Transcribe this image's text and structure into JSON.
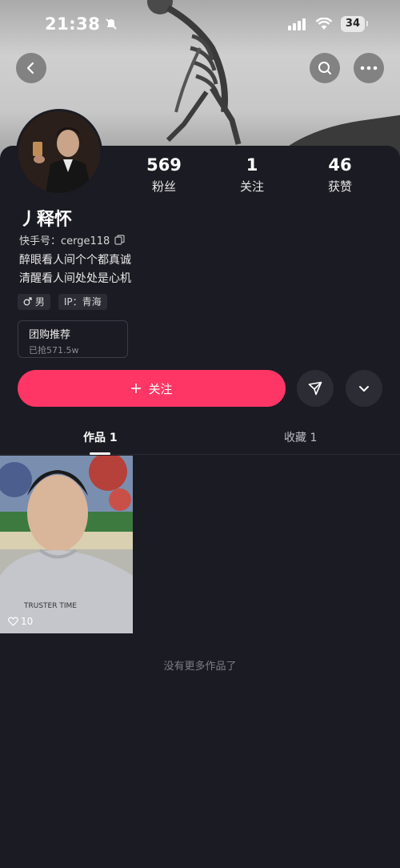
{
  "status_bar": {
    "time": "21:38",
    "battery": "34"
  },
  "profile": {
    "stats": [
      {
        "value": "569",
        "label": "粉丝"
      },
      {
        "value": "1",
        "label": "关注"
      },
      {
        "value": "46",
        "label": "获赞"
      }
    ],
    "nickname": "丿释怀",
    "kuaishou_id": "快手号：cerge118",
    "bio_line1": "醉眼看人间个个都真诚",
    "bio_line2": "清醒看人间处处是心机",
    "gender_tag": "男",
    "ip_tag": "IP：青海",
    "group_buy": {
      "title": "团购推荐",
      "subtitle": "已抢571.5w"
    }
  },
  "actions": {
    "follow_label": "关注"
  },
  "tabs": [
    {
      "label": "作品 1"
    },
    {
      "label": "收藏 1"
    }
  ],
  "works": [
    {
      "likes": "10"
    }
  ],
  "end_text": "没有更多作品了",
  "colors": {
    "accent": "#fe3666",
    "background": "#1b1b23"
  }
}
